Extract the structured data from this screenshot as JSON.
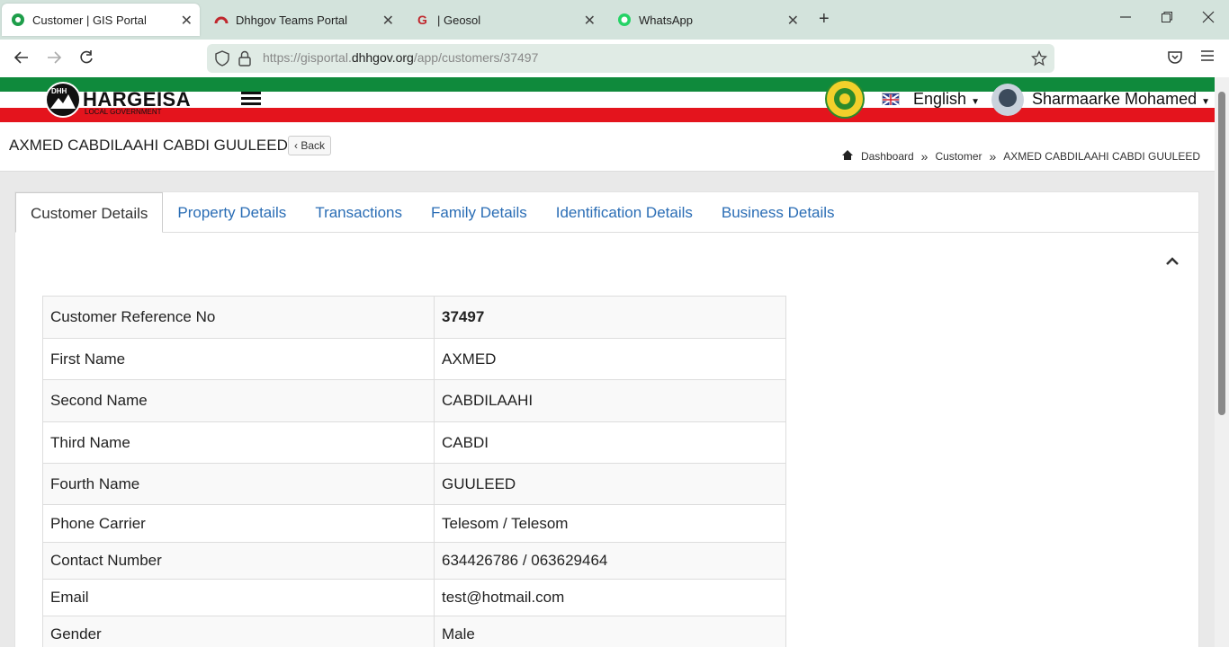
{
  "browser": {
    "tabs": [
      {
        "title": "Customer | GIS Portal",
        "icon": "gis-portal-icon",
        "active": true
      },
      {
        "title": "Dhhgov Teams Portal",
        "icon": "teams-portal-icon",
        "active": false
      },
      {
        "title": "| Geosol",
        "icon": "geosol-icon",
        "active": false
      },
      {
        "title": "WhatsApp",
        "icon": "whatsapp-icon",
        "active": false
      }
    ],
    "close_glyph": "✕",
    "new_tab_glyph": "+",
    "url_prefix": "https://gisportal.",
    "url_domain": "dhhgov.org",
    "url_path": "/app/customers/37497"
  },
  "header": {
    "logo_title": "HARGEISA",
    "logo_subtitle": "LOCAL GOVERNMENT",
    "logo_mark": "DHH",
    "language": "English",
    "user_name": "Sharmaarke Mohamed",
    "colors": {
      "green": "#0f8a3c",
      "white": "#ffffff",
      "red": "#e4141d"
    }
  },
  "page": {
    "title": "AXMED CABDILAAHI CABDI GUULEED",
    "back_label": "Back",
    "breadcrumb": [
      "Dashboard",
      "Customer",
      "AXMED CABDILAAHI CABDI GUULEED"
    ],
    "breadcrumb_separator": "»"
  },
  "tabs": [
    {
      "label": "Customer Details",
      "active": true
    },
    {
      "label": "Property Details",
      "active": false
    },
    {
      "label": "Transactions",
      "active": false
    },
    {
      "label": "Family Details",
      "active": false
    },
    {
      "label": "Identification Details",
      "active": false
    },
    {
      "label": "Business Details",
      "active": false
    }
  ],
  "details": [
    {
      "label": "Customer Reference No",
      "value": "37497"
    },
    {
      "label": "First Name",
      "value": "AXMED"
    },
    {
      "label": "Second Name",
      "value": "CABDILAAHI"
    },
    {
      "label": "Third Name",
      "value": "CABDI"
    },
    {
      "label": "Fourth Name",
      "value": "GUULEED"
    },
    {
      "label": "Phone Carrier",
      "value": "Telesom / Telesom"
    },
    {
      "label": "Contact Number",
      "value": "634426786 / 063629464"
    },
    {
      "label": "Email",
      "value": "test@hotmail.com"
    },
    {
      "label": "Gender",
      "value": "Male"
    }
  ]
}
